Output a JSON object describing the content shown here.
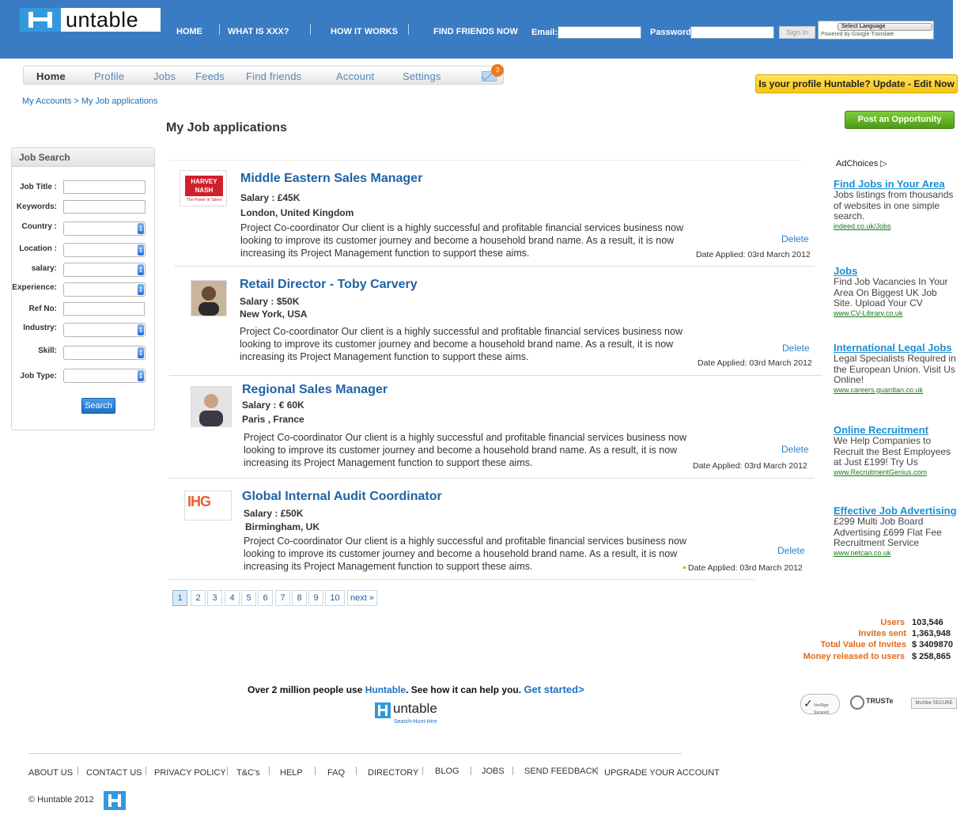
{
  "header": {
    "logo_text": "untable",
    "nav": [
      "HOME",
      "WHAT IS XXX?",
      "HOW IT WORKS",
      "FIND FRIENDS NOW"
    ],
    "email_label": "Email:",
    "password_label": "Password:",
    "signin_label": "Sign In",
    "language_select": "Select Language",
    "powered_by": "Powered by Google Translate"
  },
  "subnav": {
    "items": [
      "Home",
      "Profile",
      "Jobs",
      "Feeds",
      "Find friends",
      "Account",
      "Settings"
    ],
    "mail_count": "3"
  },
  "profile_banner": "Is your profile Huntable? Update - Edit Now",
  "breadcrumb": "My Accounts > My Job applications",
  "page_title": "My Job applications",
  "post_button": "Post an Opportunity",
  "job_search": {
    "title": "Job Search",
    "fields": [
      {
        "label": "Job Title :",
        "type": "text"
      },
      {
        "label": "Keywords:",
        "type": "text"
      },
      {
        "label": "Country :",
        "type": "select"
      },
      {
        "label": "Location :",
        "type": "select"
      },
      {
        "label": "salary:",
        "type": "select"
      },
      {
        "label": "Experience:",
        "type": "select"
      },
      {
        "label": "Ref No:",
        "type": "text"
      },
      {
        "label": "Industry:",
        "type": "select"
      },
      {
        "label": "Skill:",
        "type": "select"
      },
      {
        "label": "Job Type:",
        "type": "select"
      }
    ],
    "search_button": "Search"
  },
  "jobs": [
    {
      "logo_text": "HARVEY NASH",
      "logo_sub": "The Power of Talent",
      "title": "Middle Eastern Sales Manager",
      "salary": "Salary : £45K",
      "location": "London, United Kingdom",
      "description": "Project Co-coordinator Our client is a highly successful and profitable financial services business now looking to improve its customer journey and become a household brand name. As a result, it is now increasing its Project Management function to support these aims.",
      "delete": "Delete",
      "date": "Date Applied: 03rd March 2012"
    },
    {
      "logo_text": "",
      "title": "Retail Director - Toby Carvery",
      "salary": "Salary : $50K",
      "location": "New York, USA",
      "description": "Project Co-coordinator Our client is a highly successful and profitable financial services business now looking to improve its customer journey and become a household brand name. As a result, it is now increasing its Project Management function to support these aims.",
      "delete": "Delete",
      "date": "Date Applied: 03rd March 2012"
    },
    {
      "logo_text": "",
      "title": "Regional Sales Manager",
      "salary": "Salary : € 60K",
      "location": "Paris , France",
      "description": "Project Co-coordinator Our client is a highly successful and profitable financial services business now looking to improve its customer journey and become a household brand name. As a result, it is now increasing its Project Management function to support these aims.",
      "delete": "Delete",
      "date": "Date Applied: 03rd March 2012"
    },
    {
      "logo_text": "IHG",
      "title": "Global Internal Audit Coordinator",
      "salary": "Salary : £50K",
      "location": "Birmingham, UK",
      "description": "Project Co-coordinator Our client is a highly successful and profitable financial services business now looking to improve its customer journey and become a household brand name. As a result, it is now increasing its Project Management function to support these aims.",
      "delete": "Delete",
      "date": "Date Applied: 03rd March 2012"
    }
  ],
  "pagination": [
    "1",
    "2",
    "3",
    "4",
    "5",
    "6",
    "7",
    "8",
    "9",
    "10",
    "next »"
  ],
  "ads": {
    "choices": "AdChoices",
    "items": [
      {
        "title": "Find Jobs in Your Area",
        "text": "Jobs listings from thousands of websites in one simple search.",
        "url": "indeed.co.uk/Jobs"
      },
      {
        "title": "Jobs",
        "text": "Find Job Vacancies In Your Area On Biggest UK Job Site. Upload Your CV",
        "url": "www.CV-Library.co.uk"
      },
      {
        "title": "International Legal Jobs",
        "text": "Legal Specialists Required in the European Union. Visit Us Online!",
        "url": "www.careers.guardian.co.uk"
      },
      {
        "title": "Online Recruitment",
        "text": "We Help Companies to Recruit the Best Employees at Just £199! Try Us",
        "url": "www.RecruitmentGenius.com"
      },
      {
        "title": "Effective Job Advertising",
        "text": "£299 Multi Job Board Advertising £699 Flat Fee Recruitment Service",
        "url": "www.netcan.co.uk"
      }
    ]
  },
  "stats": [
    {
      "label": "Users",
      "value": "103,546"
    },
    {
      "label": "Invites sent",
      "value": "1,363,948"
    },
    {
      "label": "Total Value of Invites",
      "value": "$ 3409870"
    },
    {
      "label": "Money released to users",
      "value": "$ 258,865"
    }
  ],
  "promo": {
    "pre": "Over 2 million people use ",
    "brand": "Huntable",
    "post": ". See how it can help you. ",
    "cta": "Get started>",
    "logo_text": "untable",
    "tagline": "Search-Hunt-Hire"
  },
  "trust": [
    "VeriSign Secured",
    "TRUSTe",
    "McAfee SECURE"
  ],
  "footer": {
    "links": [
      "ABOUT US",
      "CONTACT US",
      "PRIVACY POLICY",
      "T&C's",
      "HELP",
      "FAQ",
      "DIRECTORY",
      "BLOG",
      "JOBS",
      "SEND FEEDBACK",
      "UPGRADE YOUR ACCOUNT"
    ],
    "copyright": "© Huntable 2012"
  },
  "colors": {
    "header_blue": "#3a7cc3",
    "link_blue": "#1d63a4",
    "accent_orange": "#e06a1b",
    "green_button": "#4c9b18",
    "yellow_banner": "#f7c514"
  }
}
